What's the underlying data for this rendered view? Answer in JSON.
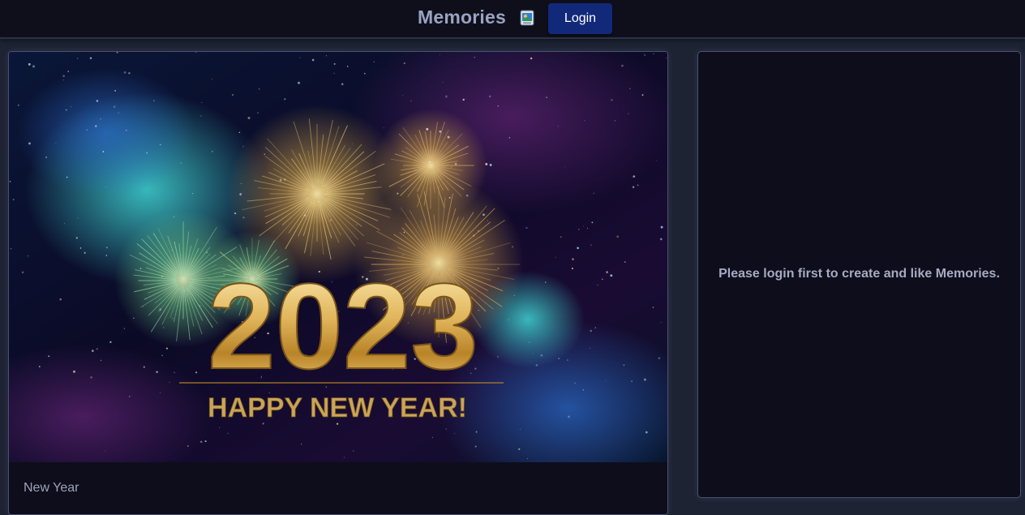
{
  "header": {
    "title": "Memories",
    "brand_icon": "memories-photo-icon",
    "login_label": "Login"
  },
  "memory_card": {
    "image": {
      "description_icon": "new-year-fireworks-image",
      "year_text": "2023",
      "greeting_text": "HAPPY NEW YEAR!"
    },
    "tags": "New Year"
  },
  "side_panel": {
    "message": "Please login first to create and like Memories."
  },
  "colors": {
    "appbar_bg": "#0f0f1c",
    "page_bg": "#1e2333",
    "button_bg": "#12297a",
    "title_text": "#9aa3c2"
  }
}
